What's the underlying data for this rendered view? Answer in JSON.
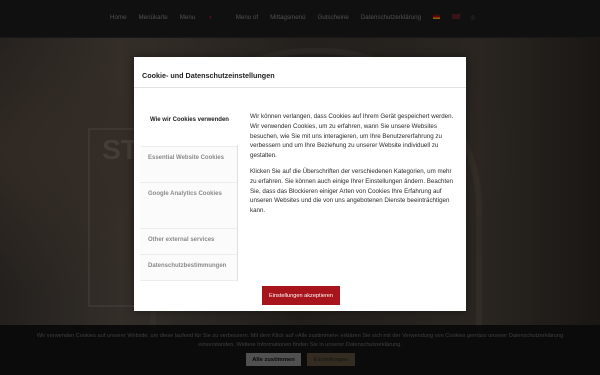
{
  "nav": {
    "items": [
      "Home",
      "Menükarte",
      "Menu",
      "Menu of",
      "Mittagsmenü",
      "Gutscheine",
      "Datenschutzerklärung"
    ],
    "menu_caret": "▾"
  },
  "hero": {
    "sign_text": "ST"
  },
  "modal": {
    "title": "Cookie- und Datenschutzeinstellungen",
    "tabs": [
      "Wie wir Cookies verwenden",
      "Essential Website Cookies",
      "Google Analytics Cookies",
      "Other external services",
      "Datenschutzbestimmungen"
    ],
    "paragraphs": [
      "Wir können verlangen, dass Cookies auf Ihrem Gerät gespeichert werden. Wir verwenden Cookies, um zu erfahren, wann Sie unsere Websites besuchen, wie Sie mit uns interagieren, um Ihre Benutzererfahrung zu verbessern und um Ihre Beziehung zu unserer Website individuell zu gestalten.",
      "Klicken Sie auf die Überschriften der verschiedenen Kategorien, um mehr zu erfahren. Sie können auch einige Ihrer Einstellungen ändern. Beachten Sie, dass das Blockieren einiger Arten von Cookies Ihre Erfahrung auf unseren Websites und die von uns angebotenen Dienste beeinträchtigen kann."
    ],
    "accept_button": "Einstellungen akzeptieren"
  },
  "cookiebar": {
    "text": "Wir verwenden Cookies auf unserer Website, um diese laufend für Sie zu verbessern. Mit dem Klick auf »Alle zustimmen« erklären Sie sich mit der Verwendung von Cookies gemäss unserer Datenschutzerklärung einverstanden. Weitere Informationen finden Sie in unserer Datenschutzerklärung.",
    "accept_all": "Alle zustimmen",
    "settings": "Einstellungen"
  },
  "colors": {
    "accent": "#a8141b",
    "background": "#1b1b1b"
  },
  "icons": [
    "flag-de-icon",
    "flag-en-icon",
    "facebook-icon",
    "instagram-icon"
  ]
}
